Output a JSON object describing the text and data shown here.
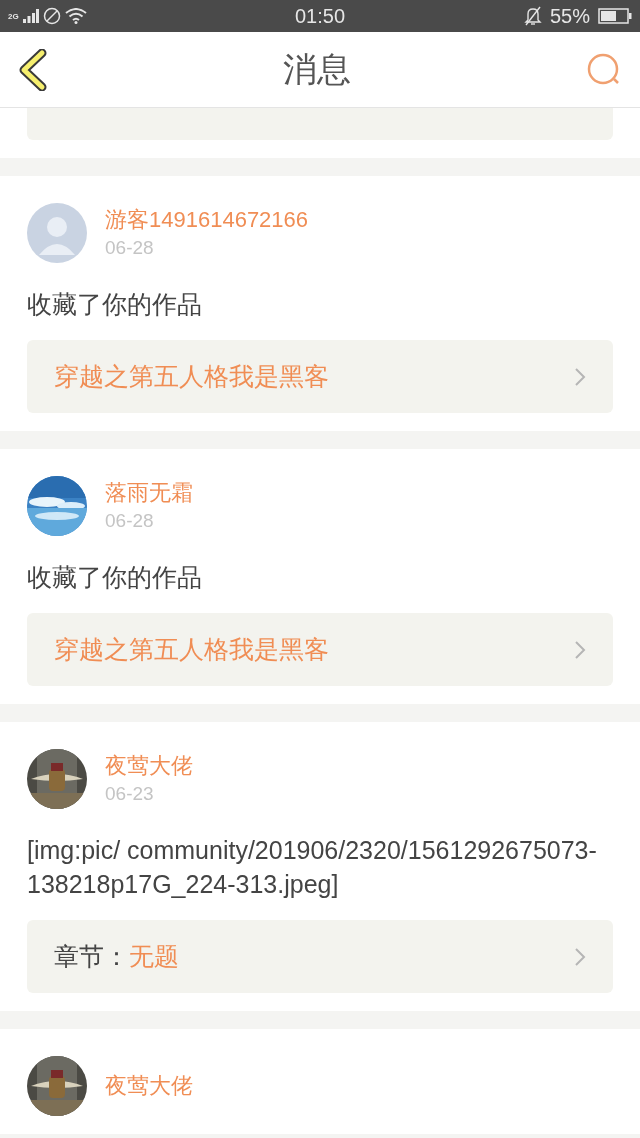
{
  "status_bar": {
    "network": "2G",
    "time": "01:50",
    "battery": "55%"
  },
  "header": {
    "title": "消息"
  },
  "messages": [
    {
      "user": "游客1491614672166",
      "date": "06-28",
      "kind": "default_avatar",
      "text": "收藏了你的作品",
      "link": {
        "title": "穿越之第五人格我是黑客"
      }
    },
    {
      "user": "落雨无霜",
      "date": "06-28",
      "kind": "photo_avatar",
      "text": "收藏了你的作品",
      "link": {
        "title": "穿越之第五人格我是黑客"
      }
    },
    {
      "user": "夜莺大佬",
      "date": "06-23",
      "kind": "photo_avatar",
      "text": "[img:pic/ community/201906/2320/1561292675073-138218p17G_224-313.jpeg]",
      "link": {
        "prefix": "章节：",
        "title": "无题"
      }
    },
    {
      "user": "夜莺大佬",
      "kind": "photo_avatar"
    }
  ]
}
